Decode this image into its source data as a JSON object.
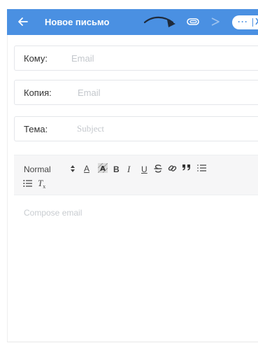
{
  "header": {
    "title": "Новое письмо",
    "more_label": "···",
    "close_label": "X"
  },
  "fields": {
    "to": {
      "label": "Кому:",
      "placeholder": "Email",
      "value": ""
    },
    "cc": {
      "label": "Копия:",
      "placeholder": "Email",
      "value": ""
    },
    "subject": {
      "label": "Тема:",
      "placeholder": "Subject",
      "value": ""
    }
  },
  "toolbar": {
    "format": "Normal",
    "sizes_icon": "⬍",
    "color": "A",
    "bold": "B",
    "italic": "I",
    "underline": "U",
    "strike": "S",
    "link_icon": "🔗",
    "quote": "99",
    "clear": "T",
    "clear_sub": "x"
  },
  "editor": {
    "placeholder": "Compose email"
  },
  "colors": {
    "header_bg": "#4a90e2",
    "toolbar_bg": "#f6f6f7",
    "placeholder": "#c3c7cc"
  }
}
